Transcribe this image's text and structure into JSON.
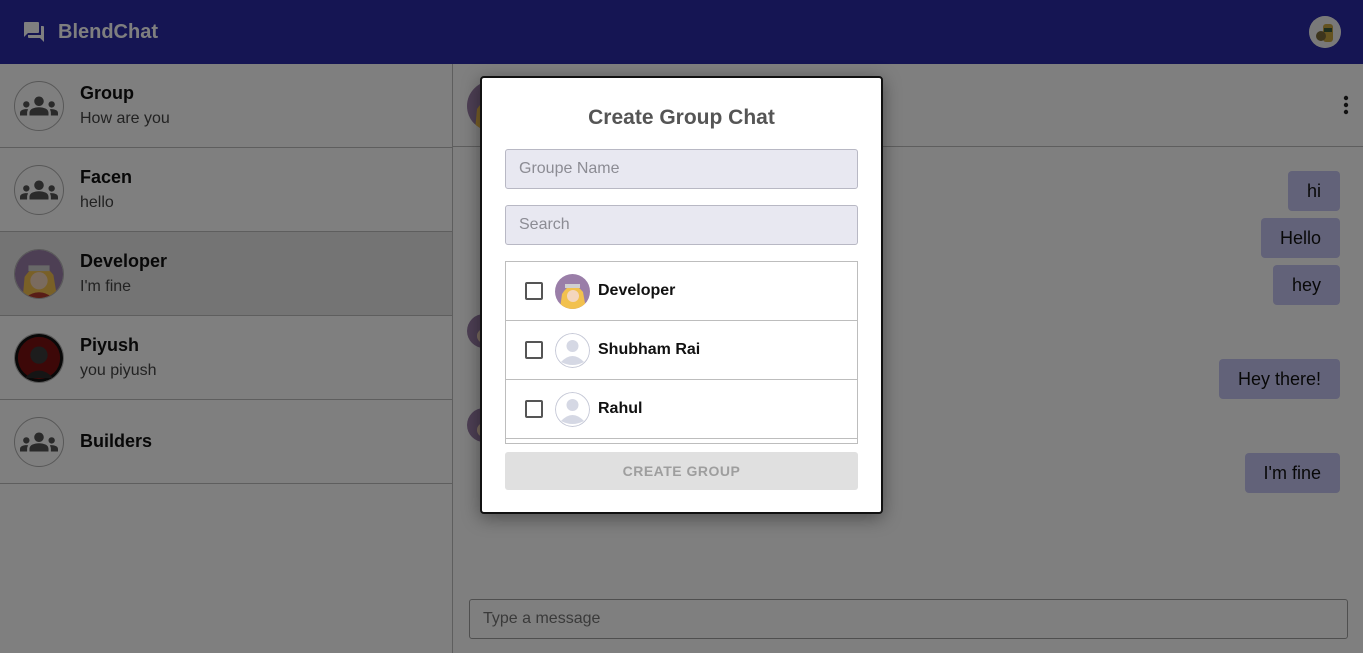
{
  "app": {
    "name": "BlendChat",
    "brand_color": "#2a2aa6"
  },
  "sidebar": {
    "chats": [
      {
        "name": "Group",
        "last_message": "How are you",
        "avatar": "group-icon"
      },
      {
        "name": "Facen",
        "last_message": "hello",
        "avatar": "group-icon"
      },
      {
        "name": "Developer",
        "last_message": "I'm fine",
        "avatar": "anime-avatar"
      },
      {
        "name": "Piyush",
        "last_message": "you piyush",
        "avatar": "dark-avatar"
      },
      {
        "name": "Builders",
        "last_message": "",
        "avatar": "group-icon"
      }
    ],
    "active_index": 2
  },
  "conversation": {
    "messages": [
      {
        "text": "hi",
        "from": "me"
      },
      {
        "text": "Hello",
        "from": "me"
      },
      {
        "text": "hey",
        "from": "me"
      },
      {
        "text": "Hey there!",
        "from": "me"
      },
      {
        "text": "I'm fine",
        "from": "me"
      }
    ],
    "composer_placeholder": "Type a message"
  },
  "modal": {
    "title": "Create Group Chat",
    "group_name_placeholder": "Groupe Name",
    "search_placeholder": "Search",
    "users": [
      {
        "name": "Developer",
        "avatar": "anime-avatar",
        "checked": false
      },
      {
        "name": "Shubham Rai",
        "avatar": "default-user-icon",
        "checked": false
      },
      {
        "name": "Rahul",
        "avatar": "default-user-icon",
        "checked": false
      }
    ],
    "create_button_label": "CREATE GROUP",
    "create_button_enabled": false
  }
}
